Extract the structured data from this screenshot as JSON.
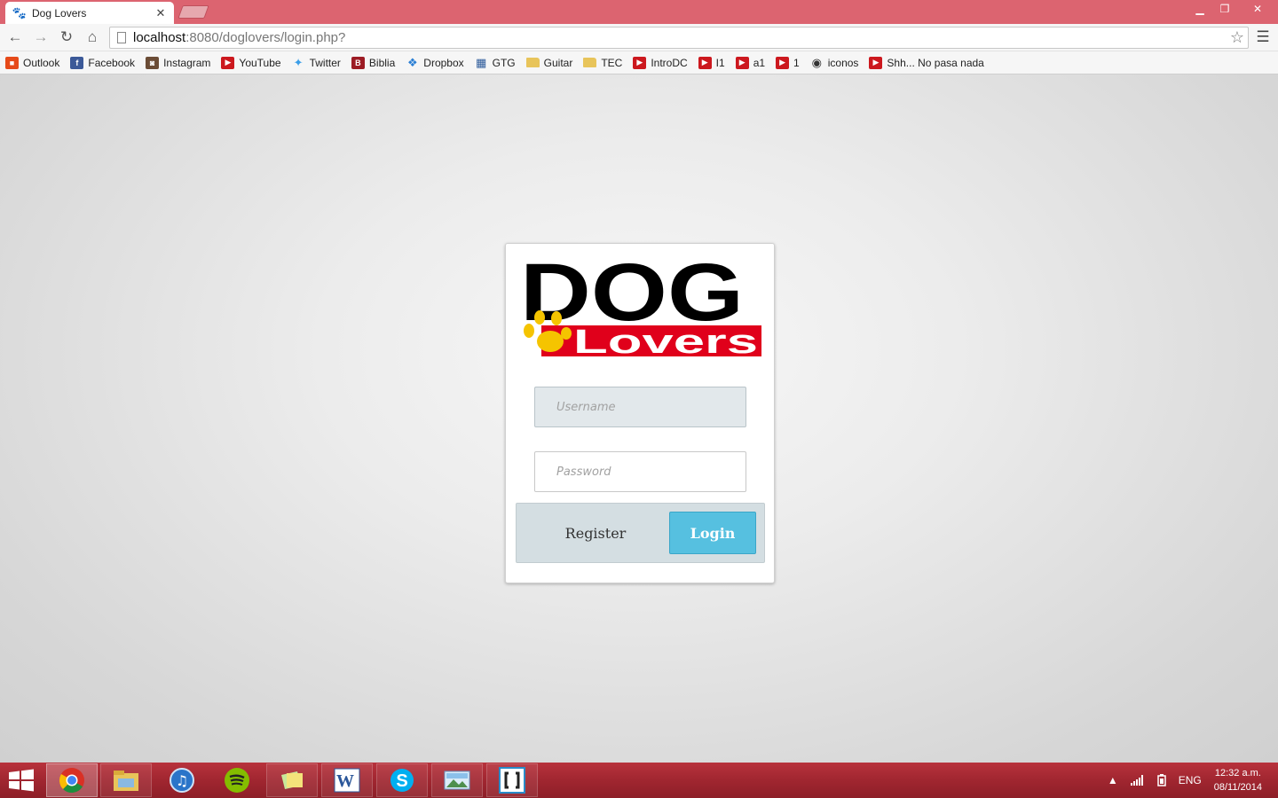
{
  "browser": {
    "tab_title": "Dog Lovers",
    "url_host": "localhost",
    "url_rest": ":8080/doglovers/login.php?"
  },
  "bookmarks": [
    {
      "label": "Outlook",
      "icon": "outlook-icon",
      "color": "#e64a19"
    },
    {
      "label": "Facebook",
      "icon": "facebook-icon",
      "color": "#3b5998"
    },
    {
      "label": "Instagram",
      "icon": "instagram-icon",
      "color": "#6b4c36"
    },
    {
      "label": "YouTube",
      "icon": "youtube-icon",
      "color": "#cc181e"
    },
    {
      "label": "Twitter",
      "icon": "twitter-icon",
      "color": "#3a9ee8"
    },
    {
      "label": "Biblia",
      "icon": "biblia-icon",
      "color": "#9c1b24"
    },
    {
      "label": "Dropbox",
      "icon": "dropbox-icon",
      "color": "#2a7fd4"
    },
    {
      "label": "GTG",
      "icon": "grid-icon",
      "color": "#2c5a9a"
    },
    {
      "label": "Guitar",
      "icon": "folder-icon",
      "color": "#e8c45a"
    },
    {
      "label": "TEC",
      "icon": "folder-icon",
      "color": "#e8c45a"
    },
    {
      "label": "IntroDC",
      "icon": "youtube-icon",
      "color": "#cc181e"
    },
    {
      "label": "I1",
      "icon": "youtube-icon",
      "color": "#cc181e"
    },
    {
      "label": "a1",
      "icon": "youtube-icon",
      "color": "#cc181e"
    },
    {
      "label": "1",
      "icon": "youtube-icon",
      "color": "#cc181e"
    },
    {
      "label": "iconos",
      "icon": "eye-icon",
      "color": "#333333"
    },
    {
      "label": "Shh... No pasa nada",
      "icon": "youtube-icon",
      "color": "#cc181e"
    }
  ],
  "login": {
    "logo_word_top": "DOG",
    "logo_word_bottom": "Lovers",
    "username_placeholder": "Username",
    "password_placeholder": "Password",
    "register_label": "Register",
    "login_label": "Login"
  },
  "taskbar": {
    "language": "ENG",
    "time": "12:32 a.m.",
    "date": "08/11/2014"
  },
  "colors": {
    "accent": "#56c0e0",
    "titlebar": "#dc6470",
    "logo_red": "#e0001b",
    "paw": "#f5c400"
  }
}
